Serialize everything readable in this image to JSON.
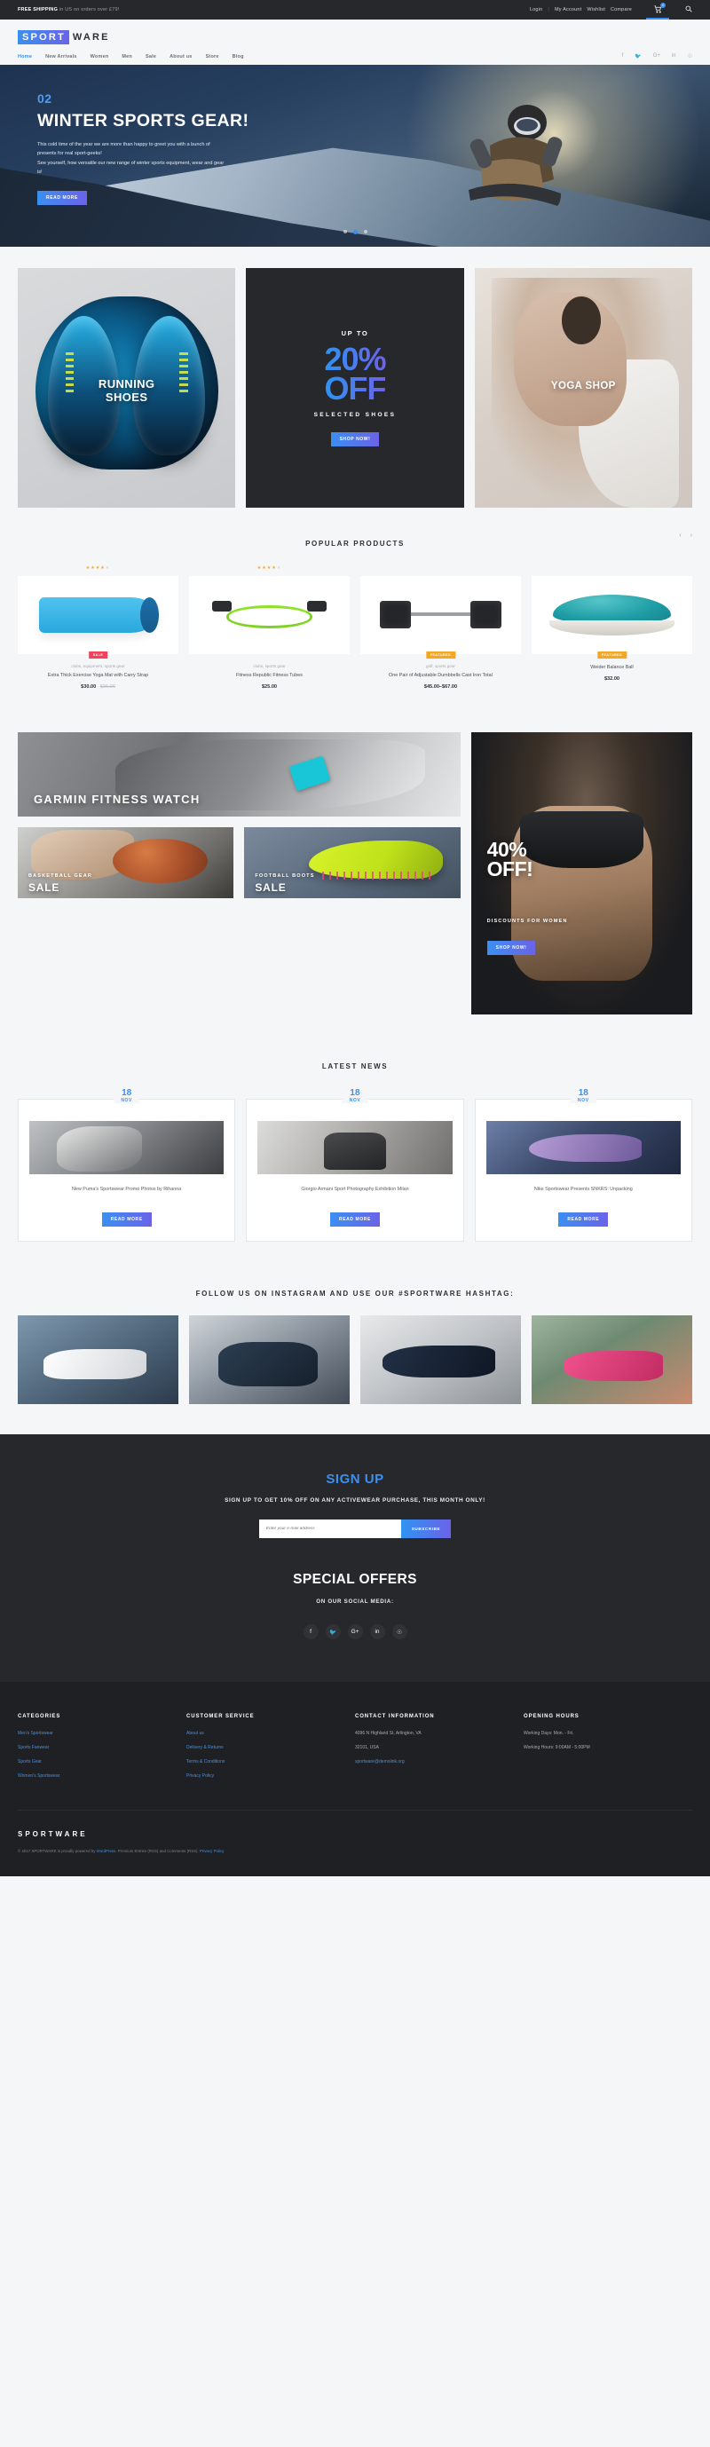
{
  "topbar": {
    "shipping_bold": "FREE SHIPPING",
    "shipping_rest": " in US on orders over £79!",
    "login": "Login",
    "separator": "|",
    "my_account": "My Account",
    "wishlist": "Wishlist",
    "compare": "Compare",
    "cart_count": "0"
  },
  "logo": {
    "blue": "SPORT",
    "dark": "WARE"
  },
  "nav": {
    "items": [
      {
        "label": "Home",
        "active": true
      },
      {
        "label": "New Arrivals",
        "active": false
      },
      {
        "label": "Women",
        "active": false
      },
      {
        "label": "Men",
        "active": false
      },
      {
        "label": "Sale",
        "active": false
      },
      {
        "label": "About us",
        "active": false
      },
      {
        "label": "Store",
        "active": false
      },
      {
        "label": "Blog",
        "active": false
      }
    ],
    "social": [
      "facebook-icon",
      "twitter-icon",
      "google-plus-icon",
      "linkedin-icon",
      "pinterest-icon"
    ]
  },
  "hero": {
    "slide_number": "02",
    "title": "WINTER SPORTS GEAR!",
    "description": "This cold time of the year we are more than happy to greet you with a bunch of presents for real sport-geeks!\nSee yourself, how versatile our new range of winter sports equipment, wear and gear is!",
    "button": "READ MORE",
    "dots": 3,
    "active_dot": 1
  },
  "promos": {
    "shoes": {
      "line1": "RUNNING",
      "line2": "SHOES"
    },
    "off": {
      "upto": "UP TO",
      "percent": "20%",
      "off": "OFF",
      "selected": "SELECTED SHOES",
      "button": "SHOP NOW!"
    },
    "yoga": {
      "title": "YOGA SHOP"
    }
  },
  "popular": {
    "heading": "POPULAR PRODUCTS",
    "prev_icon": "chevron-left-icon",
    "next_icon": "chevron-right-icon",
    "products": [
      {
        "rating": 4,
        "badge": "SALE",
        "badge_type": "sale",
        "categories": "clubs, equipment, sports gear",
        "name": "Extra Thick Exercise Yoga Mat with Carry Strap",
        "price": "$30.00",
        "old_price": "$36.00"
      },
      {
        "rating": 4,
        "badge": "",
        "badge_type": "",
        "categories": "clubs, sports gear",
        "name": "Fitness Republic Fitness Tubes",
        "price": "$25.00",
        "old_price": ""
      },
      {
        "rating": 0,
        "badge": "FEATURED",
        "badge_type": "feat",
        "categories": "golf, sports gear",
        "name": "One Pair of Adjustable Dumbbells Cast Iron Total",
        "price": "$45.00–$67.00",
        "old_price": ""
      },
      {
        "rating": 0,
        "badge": "FEATURED",
        "badge_type": "feat",
        "categories": "",
        "name": "Weider Balance Ball",
        "price": "$32.00",
        "old_price": ""
      }
    ]
  },
  "banners": {
    "garmin": "GARMIN FITNESS WATCH",
    "basketball": {
      "line1": "BASKETBALL GEAR",
      "line2": "SALE"
    },
    "football": {
      "line1": "FOOTBALL BOOTS",
      "line2": "SALE"
    },
    "women": {
      "big": "40%\nOFF!",
      "sub": "DISCOUNTS FOR WOMEN",
      "button": "SHOP NOW!"
    }
  },
  "news": {
    "heading": "LATEST NEWS",
    "items": [
      {
        "day": "18",
        "month": "NOV",
        "title": "New Puma's Sportswear Promo Photos by Rihanna",
        "button": "READ MORE"
      },
      {
        "day": "18",
        "month": "NOV",
        "title": "Giorgio Armani Sport Photography Exhibition Milan",
        "button": "READ MORE"
      },
      {
        "day": "18",
        "month": "NOV",
        "title": "Nike Sportswear Presents SNKRS: Unpacking",
        "button": "READ MORE"
      }
    ]
  },
  "instagram": {
    "heading": "FOLLOW US ON INSTAGRAM AND USE OUR #SPORTWARE HASHTAG:"
  },
  "signup": {
    "title": "SIGN UP",
    "subtitle": "SIGN UP TO GET 10% OFF ON ANY ACTIVEWEAR PURCHASE, THIS MONTH ONLY!",
    "input_placeholder": "Enter your e-mail address",
    "button": "SUBSCRIBE",
    "offers_title": "SPECIAL OFFERS",
    "offers_subtitle": "ON OUR SOCIAL MEDIA:",
    "social": [
      "facebook-icon",
      "twitter-icon",
      "google-plus-icon",
      "linkedin-icon",
      "pinterest-icon"
    ]
  },
  "footer": {
    "categories": {
      "heading": "CATEGORIES",
      "links": [
        "Men's Sportswear",
        "Sports Fanwear",
        "Sports Gear",
        "Women's Sportswear"
      ]
    },
    "customer_service": {
      "heading": "CUSTOMER SERVICE",
      "links": [
        "About us",
        "Delivery & Returns",
        "Terms & Conditions",
        "Privacy Policy"
      ]
    },
    "contact": {
      "heading": "CONTACT INFORMATION",
      "line1": "4096 N Highland St, Arlington, VA",
      "line2": "32101, USA",
      "email": "sportware@demolink.org"
    },
    "hours": {
      "heading": "OPENING HOURS",
      "line1": "Working Days: Mon. - Fri.",
      "line2": "Working Hours: 9:00AM - 5:00PM"
    },
    "brand": "SPORTWARE",
    "copyright_pre": "© 2017 SPORTWARE is proudly powered by ",
    "wp": "WordPress",
    "copyright_mid": ". Premium Entries (RSS) and Comments (RSS). ",
    "privacy": "Privacy Policy"
  },
  "colors": {
    "accent": "#3b8ff0",
    "accent2": "#6b63e8",
    "dark": "#26282c",
    "sale": "#f2415a",
    "featured": "#f5a623"
  }
}
